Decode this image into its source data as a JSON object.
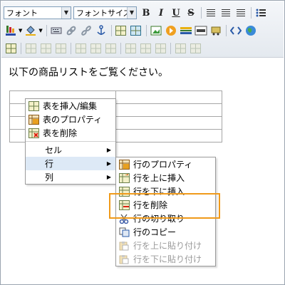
{
  "toolbar": {
    "font_select": "フォント",
    "size_select": "フォントサイズ",
    "bold": "B",
    "italic": "I",
    "underline": "U",
    "strike": "S"
  },
  "content": {
    "intro": "以下の商品リストをご覧ください。"
  },
  "context_menu": {
    "items": [
      {
        "label": "表を挿入/編集"
      },
      {
        "label": "表のプロパティ"
      },
      {
        "label": "表を削除"
      },
      {
        "label": "セル"
      },
      {
        "label": "行"
      },
      {
        "label": "列"
      }
    ]
  },
  "row_submenu": {
    "items": [
      {
        "label": "行のプロパティ"
      },
      {
        "label": "行を上に挿入"
      },
      {
        "label": "行を下に挿入"
      },
      {
        "label": "行を削除"
      },
      {
        "label": "行の切り取り"
      },
      {
        "label": "行のコピー"
      },
      {
        "label": "行を上に貼り付け"
      },
      {
        "label": "行を下に貼り付け"
      }
    ]
  },
  "colors": {
    "highlight_box": "#f09a1a",
    "hover_bg": "#dde9f6"
  }
}
